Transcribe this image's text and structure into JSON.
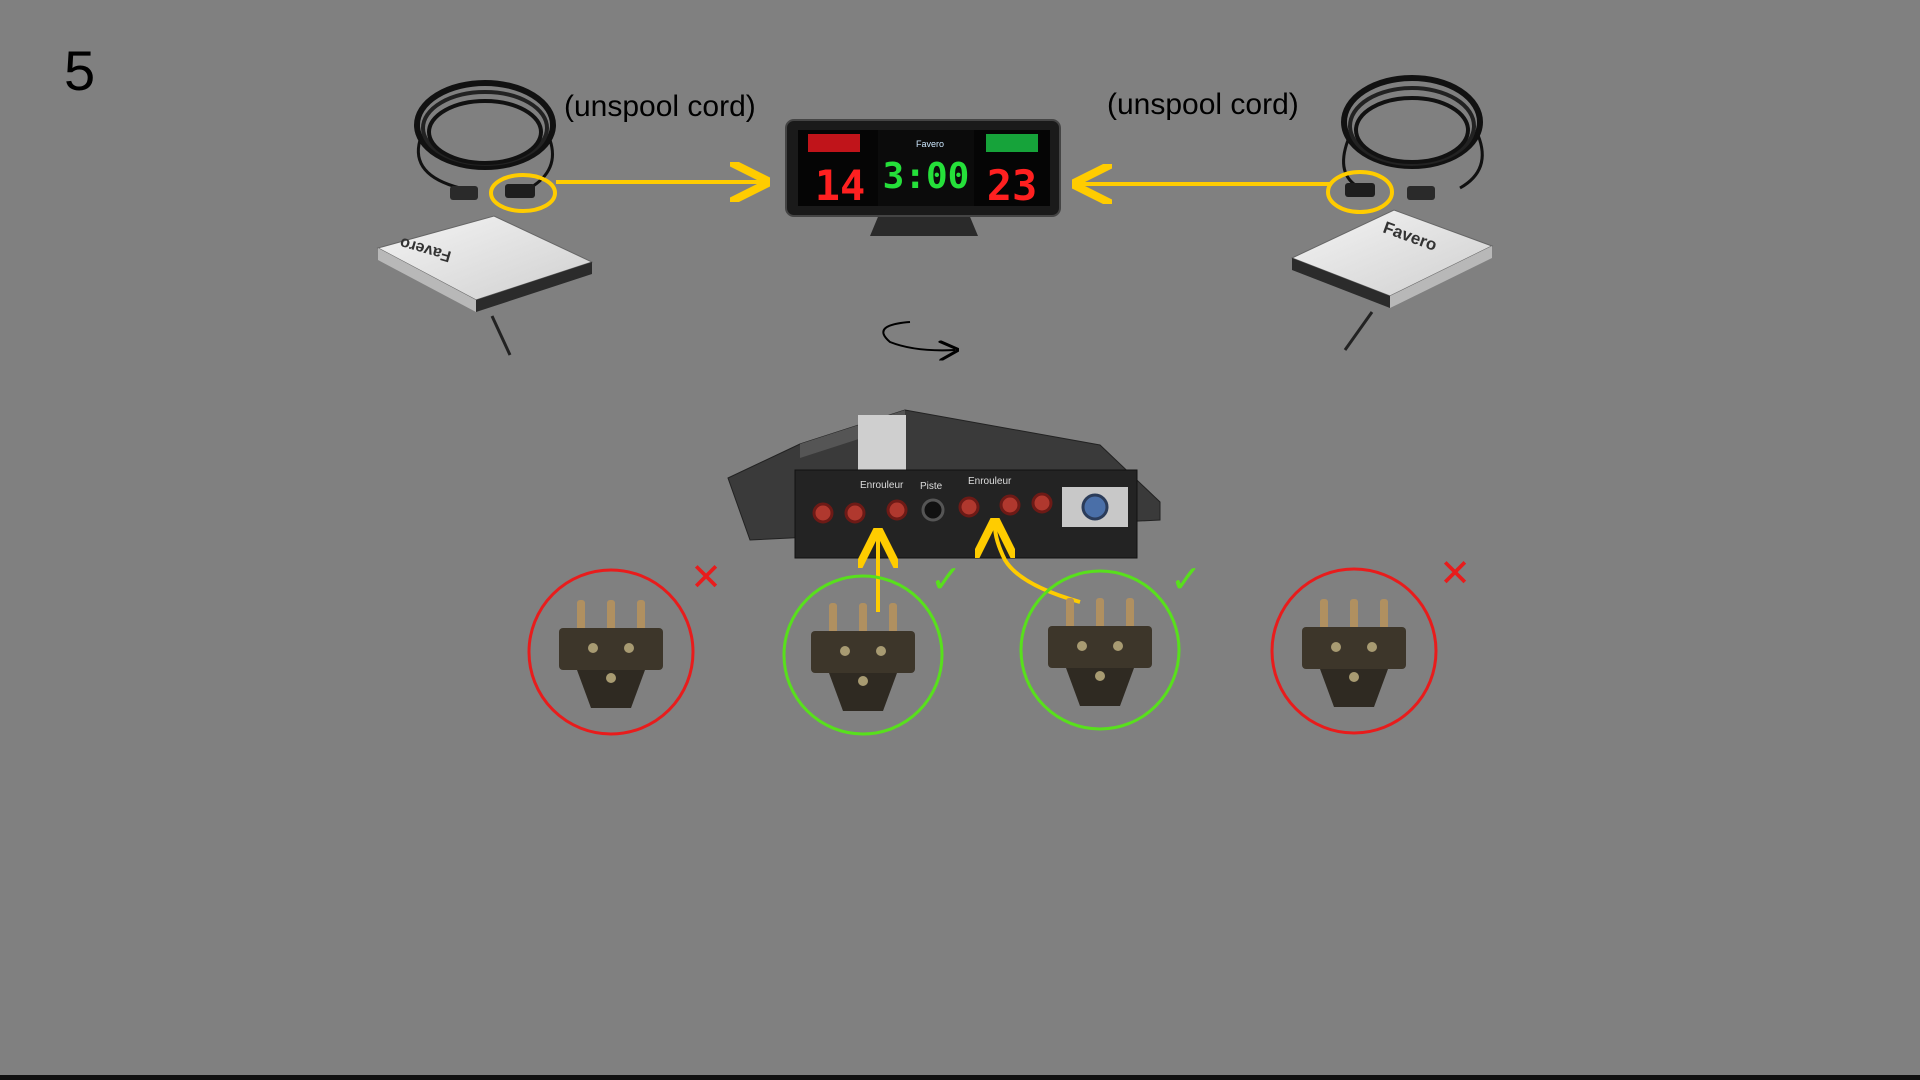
{
  "slide": {
    "step_number": "5",
    "left_note": "(unspool cord)",
    "right_note": "(unspool cord)"
  },
  "scoreboard": {
    "left_score": "14",
    "timer": "3:00",
    "right_score": "23",
    "brand": "Favero"
  },
  "reels": {
    "left_brand": "Favero",
    "right_brand": "Favero"
  },
  "connection_box": {
    "label_left": "Enrouleur",
    "label_center": "Piste",
    "label_right": "Enrouleur"
  },
  "plugs": [
    {
      "status": "wrong",
      "mark": "✕",
      "color": "#e81c1c"
    },
    {
      "status": "correct",
      "mark": "✓",
      "color": "#58e01c"
    },
    {
      "status": "correct",
      "mark": "✓",
      "color": "#58e01c"
    },
    {
      "status": "wrong",
      "mark": "✕",
      "color": "#e81c1c"
    }
  ],
  "colors": {
    "background": "#808080",
    "arrow": "#ffcc00",
    "wrong": "#e81c1c",
    "correct": "#58e01c"
  }
}
